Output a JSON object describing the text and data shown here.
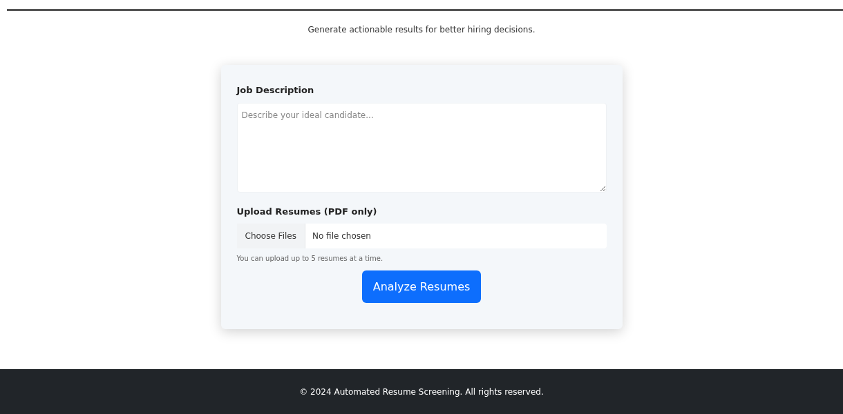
{
  "subtitle": "Generate actionable results for better hiring decisions.",
  "form": {
    "job_description": {
      "label": "Job Description",
      "placeholder": "Describe your ideal candidate..."
    },
    "upload": {
      "label": "Upload Resumes (PDF only)",
      "button": "Choose Files",
      "status": "No file chosen",
      "help": "You can upload up to 5 resumes at a time."
    },
    "submit": "Analyze Resumes"
  },
  "footer": "© 2024 Automated Resume Screening. All rights reserved."
}
